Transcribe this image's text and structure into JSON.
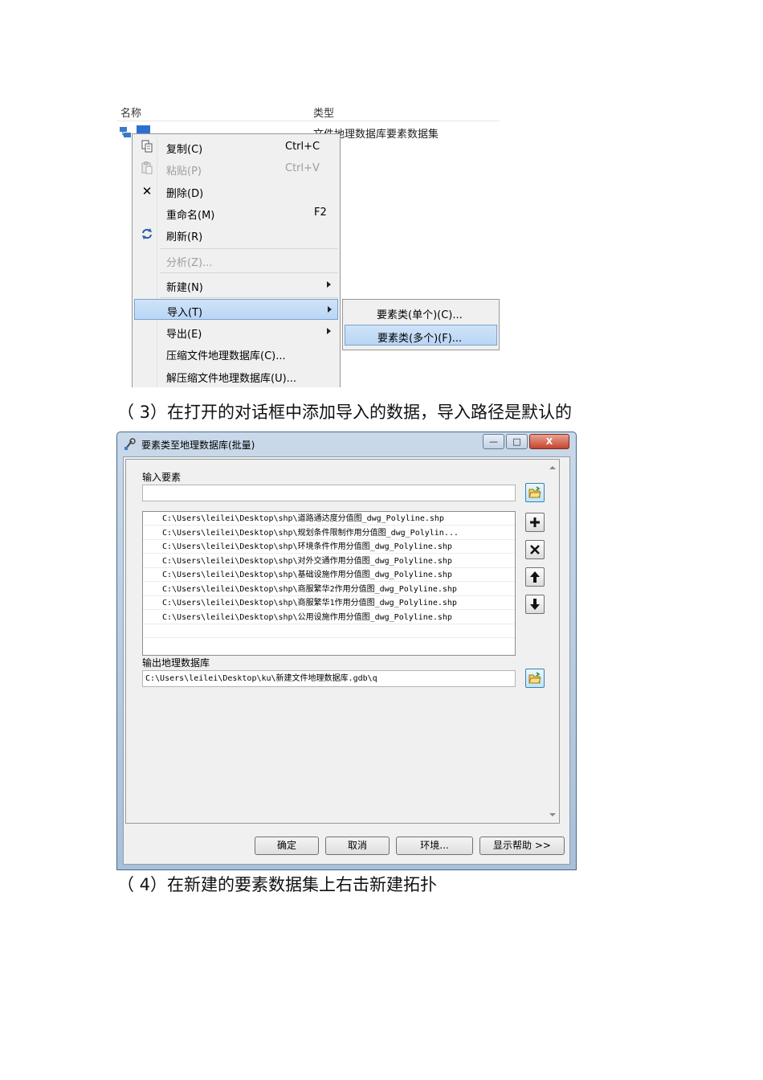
{
  "explorer": {
    "col_name": "名称",
    "col_type": "类型",
    "dataset_type": "文件地理数据库要素数据集"
  },
  "context_menu": {
    "items": [
      {
        "label": "复制(C)",
        "shortcut": "Ctrl+C",
        "icon": "copy-icon"
      },
      {
        "label": "粘贴(P)",
        "shortcut": "Ctrl+V",
        "icon": "paste-icon",
        "disabled": true
      },
      {
        "label": "删除(D)",
        "icon": "delete-icon"
      },
      {
        "label": "重命名(M)",
        "shortcut": "F2"
      },
      {
        "label": "刷新(R)",
        "icon": "refresh-icon"
      },
      {
        "label": "分析(Z)...",
        "disabled": true
      },
      {
        "label": "新建(N)",
        "submenu": true
      },
      {
        "label": "导入(T)",
        "submenu": true,
        "highlighted": true
      },
      {
        "label": "导出(E)",
        "submenu": true
      },
      {
        "label": "压缩文件地理数据库(C)..."
      },
      {
        "label": "解压缩文件地理数据库(U)..."
      }
    ]
  },
  "submenu": {
    "items": [
      {
        "label": "要素类(单个)(C)..."
      },
      {
        "label": "要素类(多个)(F)...",
        "highlighted": true
      }
    ]
  },
  "paragraphs": {
    "step3": "（ 3）在打开的对话框中添加导入的数据，导入路径是默认的",
    "step4": "（ 4）在新建的要素数据集上右击新建拓扑"
  },
  "dialog": {
    "title": "要素类至地理数据库(批量)",
    "input_label": "输入要素",
    "input_value": "",
    "input_files": [
      "C:\\Users\\leilei\\Desktop\\shp\\道路通达度分值图_dwg_Polyline.shp",
      "C:\\Users\\leilei\\Desktop\\shp\\规划条件限制作用分值图_dwg_Polylin...",
      "C:\\Users\\leilei\\Desktop\\shp\\环境条件作用分值图_dwg_Polyline.shp",
      "C:\\Users\\leilei\\Desktop\\shp\\对外交通作用分值图_dwg_Polyline.shp",
      "C:\\Users\\leilei\\Desktop\\shp\\基础设施作用分值图_dwg_Polyline.shp",
      "C:\\Users\\leilei\\Desktop\\shp\\商服繁华2作用分值图_dwg_Polyline.shp",
      "C:\\Users\\leilei\\Desktop\\shp\\商服繁华1作用分值图_dwg_Polyline.shp",
      "C:\\Users\\leilei\\Desktop\\shp\\公用设施作用分值图_dwg_Polyline.shp"
    ],
    "output_label": "输出地理数据库",
    "output_value": "C:\\Users\\leilei\\Desktop\\ku\\新建文件地理数据库.gdb\\q",
    "buttons": {
      "ok": "确定",
      "cancel": "取消",
      "env": "环境...",
      "help": "显示帮助 >>"
    },
    "window_buttons": {
      "min": "—",
      "max": "□",
      "close": "X"
    }
  }
}
